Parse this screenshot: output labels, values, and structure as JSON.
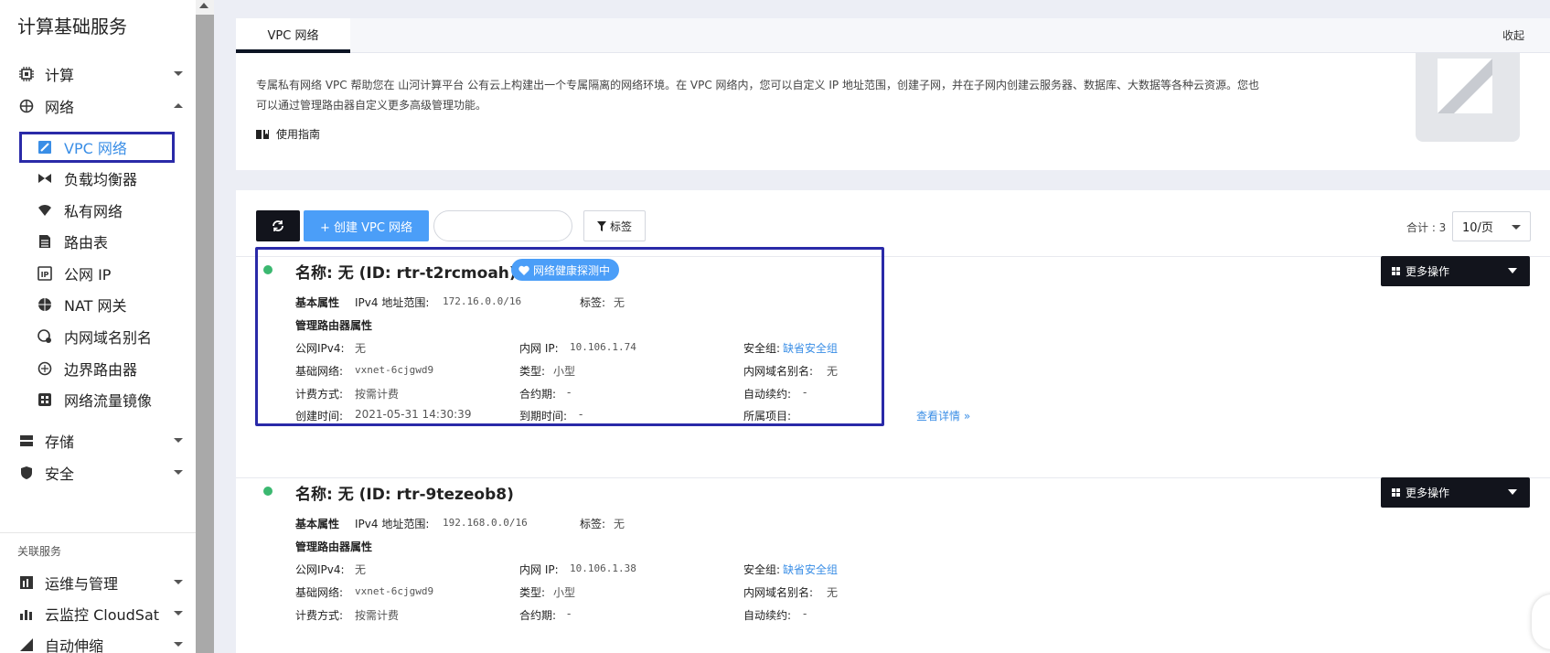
{
  "sidebar": {
    "title": "计算基础服务",
    "groups": [
      {
        "label": "计算",
        "icon": "cpu-icon"
      },
      {
        "label": "网络",
        "icon": "network-icon"
      },
      {
        "label": "存储",
        "icon": "storage-icon"
      },
      {
        "label": "安全",
        "icon": "shield-icon"
      }
    ],
    "network_items": [
      {
        "label": "VPC 网络",
        "icon": "vpc-icon"
      },
      {
        "label": "负载均衡器",
        "icon": "load-balancer-icon"
      },
      {
        "label": "私有网络",
        "icon": "wifi-icon"
      },
      {
        "label": "路由表",
        "icon": "route-table-icon"
      },
      {
        "label": "公网 IP",
        "icon": "public-ip-icon"
      },
      {
        "label": "NAT 网关",
        "icon": "nat-gateway-icon"
      },
      {
        "label": "内网域名别名",
        "icon": "dns-alias-icon"
      },
      {
        "label": "边界路由器",
        "icon": "border-router-icon"
      },
      {
        "label": "网络流量镜像",
        "icon": "traffic-mirror-icon"
      }
    ],
    "related_title": "关联服务",
    "related": [
      {
        "label": "运维与管理",
        "icon": "ops-icon"
      },
      {
        "label": "云监控 CloudSat",
        "icon": "monitor-icon"
      },
      {
        "label": "自动伸缩",
        "icon": "autoscale-icon"
      }
    ]
  },
  "tabs": {
    "active": "VPC 网络",
    "collapse": "收起"
  },
  "intro": {
    "line1": "专属私有网络 VPC 帮助您在 山河计算平台 公有云上构建出一个专属隔离的网络环境。在 VPC 网络内，您可以自定义 IP 地址范围，创建子网，并在子网内创建云服务器、数据库、大数据等各种云资源。您也",
    "line2": "可以通过管理路由器自定义更多高级管理功能。",
    "guide": "使用指南"
  },
  "toolbar": {
    "create_label": "+ 创建 VPC 网络",
    "search_value": "",
    "tag_label": "标签",
    "total": "合计 : 3",
    "page_size": "10/页"
  },
  "labels": {
    "basic_attr": "基本属性",
    "ipv4_range": "IPv4 地址范围:",
    "tag": "标签:",
    "router_attr": "管理路由器属性",
    "public_ipv4": "公网IPv4:",
    "inner_ip": "内网 IP:",
    "security_group": "安全组:",
    "base_network": "基础网络:",
    "type": "类型:",
    "dns_alias": "内网域名别名:",
    "billing": "计费方式:",
    "contract": "合约期:",
    "auto_renew": "自动续约:",
    "created": "创建时间:",
    "expire": "到期时间:",
    "project": "所属项目:",
    "more_ops": "更多操作",
    "view_detail": "查看详情 »"
  },
  "vpcs": [
    {
      "name": "名称: 无 (ID: rtr-t2rcmoah)",
      "badge": "网络健康探测中",
      "ipv4_range": "172.16.0.0/16",
      "tag": "无",
      "public_ipv4": "无",
      "inner_ip": "10.106.1.74",
      "security_group": "缺省安全组",
      "base_network": "vxnet-6cjgwd9",
      "type": "小型",
      "dns_alias": "无",
      "billing": "按需计费",
      "contract": "-",
      "auto_renew": "-",
      "created": "2021-05-31 14:30:39",
      "expire": "-",
      "project": ""
    },
    {
      "name": "名称: 无 (ID: rtr-9tezeob8)",
      "ipv4_range": "192.168.0.0/16",
      "tag": "无",
      "public_ipv4": "无",
      "inner_ip": "10.106.1.38",
      "security_group": "缺省安全组",
      "base_network": "vxnet-6cjgwd9",
      "type": "小型",
      "dns_alias": "无",
      "billing": "按需计费",
      "contract": "-",
      "auto_renew": "-"
    }
  ],
  "colors": {
    "accent": "#4b9ef8",
    "dark_button": "#12141c",
    "highlight_border": "#2a2aa8",
    "status_running": "#3bb870",
    "link": "#3a8ee6"
  }
}
